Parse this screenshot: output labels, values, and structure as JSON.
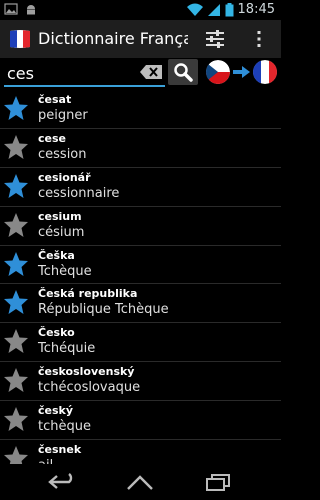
{
  "status_bar": {
    "time": "18:45"
  },
  "app": {
    "title": "Dictionnaire Françai…"
  },
  "search": {
    "value": "ces",
    "placeholder": ""
  },
  "colors": {
    "accent": "#3aa0d8",
    "star_active": "#2f8fd8",
    "star_inactive": "#888888"
  },
  "entries": [
    {
      "word": "česat",
      "translation": "peigner",
      "starred": true
    },
    {
      "word": "cese",
      "translation": "cession",
      "starred": false
    },
    {
      "word": "cesionář",
      "translation": "cessionnaire",
      "starred": true
    },
    {
      "word": "cesium",
      "translation": "césium",
      "starred": false
    },
    {
      "word": "Češka",
      "translation": "Tchèque",
      "starred": true
    },
    {
      "word": "Česká republika",
      "translation": "République Tchèque",
      "starred": true
    },
    {
      "word": "Česko",
      "translation": "Tchéquie",
      "starred": false
    },
    {
      "word": "československý",
      "translation": "tchécoslovaque",
      "starred": false
    },
    {
      "word": "český",
      "translation": "tchèque",
      "starred": false
    },
    {
      "word": "česnek",
      "translation": "ail",
      "starred": false
    }
  ],
  "icons": {
    "app": "flag-icon",
    "settings": "sliders-icon",
    "overflow": "overflow-menu-icon",
    "clear": "backspace-icon",
    "search": "search-icon",
    "source_lang": "czech-flag-icon",
    "direction": "arrow-right-icon",
    "target_lang": "french-flag-icon",
    "back": "back-icon",
    "home": "home-icon",
    "recents": "recents-icon"
  }
}
